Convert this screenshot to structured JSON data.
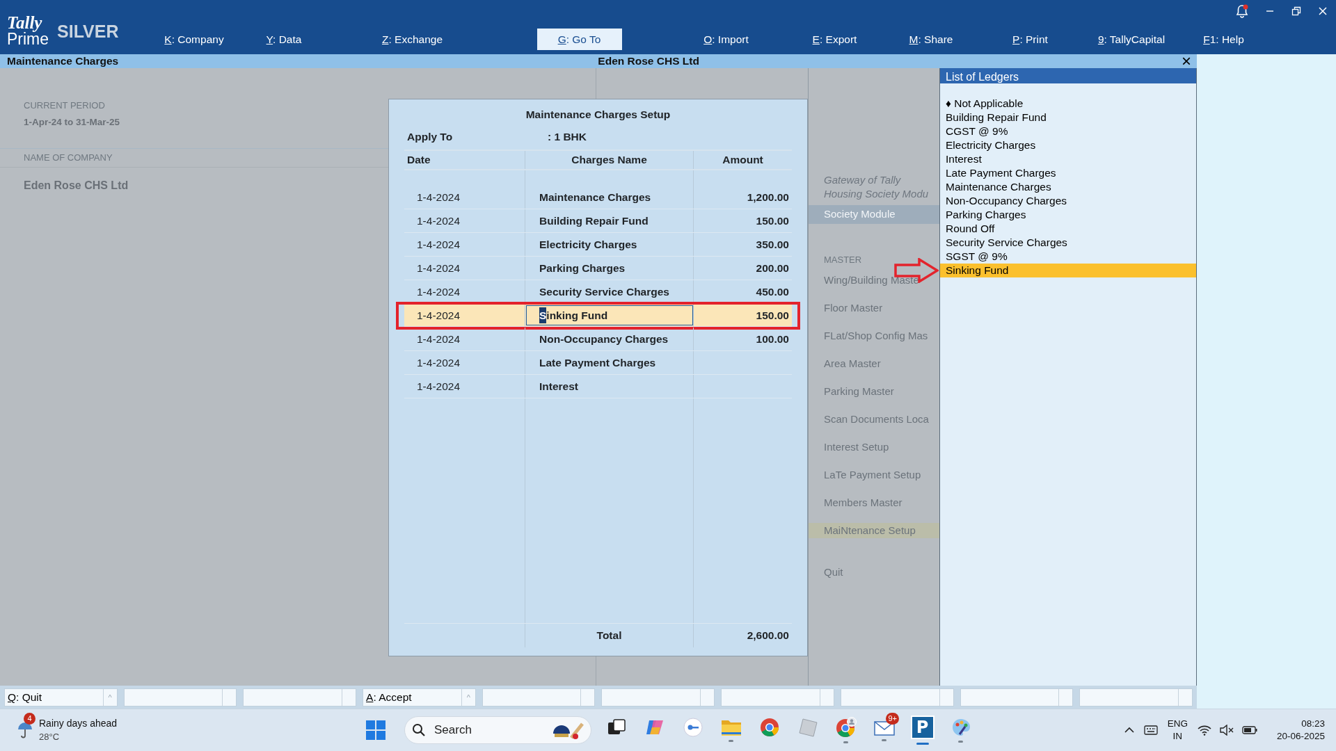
{
  "app": {
    "logo_top": "Tally",
    "logo_bottom": "Prime",
    "edition": "SILVER"
  },
  "menu": [
    {
      "hotkey": "K:",
      "label": "Company",
      "selected": false
    },
    {
      "hotkey": "Y:",
      "label": "Data",
      "selected": false
    },
    {
      "hotkey": "Z:",
      "label": "Exchange",
      "selected": false
    },
    {
      "hotkey": "G:",
      "label": "Go To",
      "selected": true
    },
    {
      "hotkey": "O:",
      "label": "Import",
      "selected": false
    },
    {
      "hotkey": "E:",
      "label": "Export",
      "selected": false
    },
    {
      "hotkey": "M:",
      "label": "Share",
      "selected": false
    },
    {
      "hotkey": "P:",
      "label": "Print",
      "selected": false
    },
    {
      "hotkey": "9:",
      "label": "TallyCapital",
      "selected": false
    },
    {
      "hotkey": "F1:",
      "label": "Help",
      "selected": false
    }
  ],
  "title_bar": {
    "left": "Maintenance Charges",
    "center": "Eden Rose CHS Ltd",
    "close": "×"
  },
  "company_panel": {
    "period_label": "CURRENT PERIOD",
    "period": "1-Apr-24 to 31-Mar-25",
    "name_label": "NAME OF COMPANY",
    "name": "Eden Rose CHS Ltd"
  },
  "gateway": {
    "titles": [
      "Gateway of Tally",
      "Housing Society Modu"
    ],
    "heading": "Society Module",
    "section": "MASTER",
    "items": [
      {
        "label": "Wing/Building Maste",
        "selected": false
      },
      {
        "label": "Floor Master",
        "selected": false
      },
      {
        "label": "FLat/Shop Config Mas",
        "selected": false
      },
      {
        "label": "Area Master",
        "selected": false
      },
      {
        "label": "Parking Master",
        "selected": false
      },
      {
        "label": "Scan Documents Loca",
        "selected": false
      },
      {
        "label": "Interest Setup",
        "selected": false
      },
      {
        "label": "LaTe Payment Setup",
        "selected": false
      },
      {
        "label": "Members Master",
        "selected": false
      },
      {
        "label": "MaiNtenance Setup",
        "selected": true
      }
    ],
    "quit": "Quit"
  },
  "dialog": {
    "title": "Maintenance Charges Setup",
    "apply_label": "Apply To",
    "apply_value": ": 1 BHK",
    "columns": [
      "Date",
      "Charges Name",
      "Amount"
    ],
    "rows": [
      {
        "date": "1-4-2024",
        "name": "Maintenance Charges",
        "amount": "1,200.00",
        "selected": false,
        "marked": false
      },
      {
        "date": "1-4-2024",
        "name": "Building Repair Fund",
        "amount": "150.00",
        "selected": false,
        "marked": false
      },
      {
        "date": "1-4-2024",
        "name": "Electricity Charges",
        "amount": "350.00",
        "selected": false,
        "marked": false
      },
      {
        "date": "1-4-2024",
        "name": "Parking Charges",
        "amount": "200.00",
        "selected": false,
        "marked": false
      },
      {
        "date": "1-4-2024",
        "name": "Security Service Charges",
        "amount": "450.00",
        "selected": false,
        "marked": false
      },
      {
        "date": "1-4-2024",
        "name": "Sinking Fund",
        "amount": "150.00",
        "selected": true,
        "marked": true
      },
      {
        "date": "1-4-2024",
        "name": "Non-Occupancy Charges",
        "amount": "100.00",
        "selected": false,
        "marked": false
      },
      {
        "date": "1-4-2024",
        "name": "Late Payment Charges",
        "selected": false,
        "marked": false
      },
      {
        "date": "1-4-2024",
        "name": "Interest",
        "selected": false,
        "marked": false
      }
    ],
    "total_label": "Total",
    "total": "2,600.00"
  },
  "ledgers": {
    "title": "List of Ledgers",
    "items": [
      {
        "label": "Not Applicable",
        "bullet": "♦",
        "selected": false,
        "marked": false
      },
      {
        "label": "Building Repair Fund",
        "selected": false,
        "marked": false
      },
      {
        "label": "CGST @ 9%",
        "selected": false,
        "marked": false
      },
      {
        "label": "Electricity Charges",
        "selected": false,
        "marked": false
      },
      {
        "label": "Interest",
        "selected": false,
        "marked": false
      },
      {
        "label": "Late Payment Charges",
        "selected": false,
        "marked": false
      },
      {
        "label": "Maintenance Charges",
        "selected": false,
        "marked": false
      },
      {
        "label": "Non-Occupancy Charges",
        "selected": false,
        "marked": false
      },
      {
        "label": "Parking Charges",
        "selected": false,
        "marked": false
      },
      {
        "label": "Round Off",
        "selected": false,
        "marked": false
      },
      {
        "label": "Security Service Charges",
        "selected": false,
        "marked": false
      },
      {
        "label": "SGST @ 9%",
        "selected": false,
        "marked": false
      },
      {
        "label": "Sinking Fund",
        "selected": true,
        "marked": true
      }
    ]
  },
  "button_bar": [
    {
      "kind": "button",
      "hotkey": "Q:",
      "label": "Quit",
      "caret": "^"
    },
    {
      "kind": "blank"
    },
    {
      "kind": "blank"
    },
    {
      "kind": "button",
      "hotkey": "A:",
      "label": "Accept",
      "caret": "^"
    },
    {
      "kind": "blank"
    },
    {
      "kind": "blank"
    },
    {
      "kind": "blank"
    },
    {
      "kind": "blank"
    },
    {
      "kind": "blank"
    },
    {
      "kind": "blank"
    }
  ],
  "taskbar": {
    "weather": {
      "badge": "4",
      "text": "Rainy days ahead",
      "temp": "28°C"
    },
    "search": {
      "placeholder": "Search"
    },
    "apps": [
      {
        "kind": "taskview",
        "running": false,
        "active": false
      },
      {
        "kind": "copilot",
        "running": false,
        "active": false
      },
      {
        "kind": "meet",
        "running": false,
        "active": false
      },
      {
        "kind": "folder",
        "running": true,
        "active": false
      },
      {
        "kind": "chrome",
        "running": false,
        "active": false
      },
      {
        "kind": "cube",
        "running": false,
        "active": false
      },
      {
        "kind": "chrome-profile",
        "running": true,
        "active": false
      },
      {
        "kind": "mail",
        "badge": "9+",
        "running": true,
        "active": false
      },
      {
        "kind": "tally",
        "glyph": "P",
        "running": true,
        "active": true
      },
      {
        "kind": "paint",
        "running": true,
        "active": false
      }
    ],
    "tray": {
      "language": "ENG",
      "region": "IN",
      "time": "08:23",
      "date": "20-06-2025"
    }
  }
}
